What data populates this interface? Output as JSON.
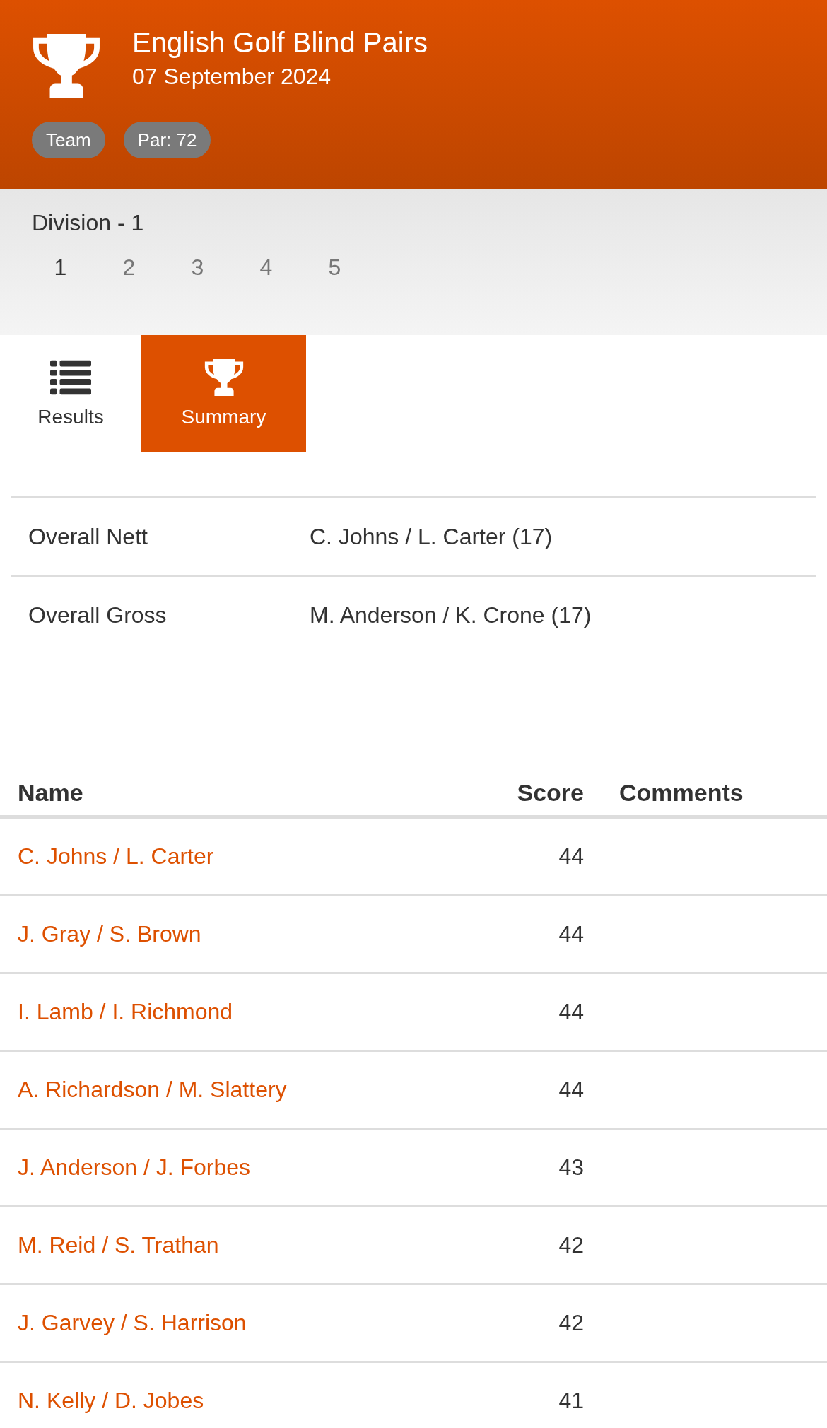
{
  "header": {
    "title": "English Golf Blind Pairs",
    "date": "07 September 2024",
    "badges": [
      "Team",
      "Par: 72"
    ]
  },
  "division": {
    "label": "Division - 1",
    "pages": [
      {
        "label": "1",
        "selected": true
      },
      {
        "label": "2",
        "selected": false
      },
      {
        "label": "3",
        "selected": false
      },
      {
        "label": "4",
        "selected": false
      },
      {
        "label": "5",
        "selected": false
      }
    ]
  },
  "tabs": [
    {
      "label": "Results",
      "kind": "list",
      "selected": false
    },
    {
      "label": "Summary",
      "kind": "trophy",
      "selected": true
    }
  ],
  "summary": [
    {
      "label": "Overall Nett",
      "value": "C. Johns / L. Carter (17)"
    },
    {
      "label": "Overall Gross",
      "value": "M. Anderson / K. Crone (17)"
    }
  ],
  "table": {
    "columns": [
      "Name",
      "Score",
      "Comments"
    ],
    "rows": [
      {
        "name": "C. Johns / L. Carter",
        "score": "44"
      },
      {
        "name": "J. Gray / S. Brown",
        "score": "44"
      },
      {
        "name": "I. Lamb / I. Richmond",
        "score": "44"
      },
      {
        "name": "A. Richardson / M. Slattery",
        "score": "44"
      },
      {
        "name": "J. Anderson / J. Forbes",
        "score": "43"
      },
      {
        "name": "M. Reid / S. Trathan",
        "score": "42"
      },
      {
        "name": "J. Garvey / S. Harrison",
        "score": "42"
      },
      {
        "name": "N. Kelly / D. Jobes",
        "score": "41"
      }
    ]
  }
}
